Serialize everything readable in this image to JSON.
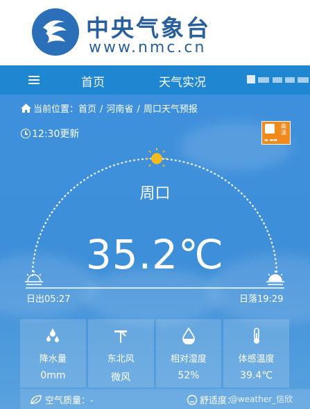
{
  "header": {
    "brand_cn": "中央气象台",
    "brand_url": "www.nmc.cn",
    "logo_icon": "cma-logo-icon"
  },
  "nav": {
    "menu_icon": "hamburger-menu-icon",
    "items": [
      {
        "label": "首页"
      },
      {
        "label": "天气实况"
      }
    ]
  },
  "breadcrumb": {
    "prefix": "当前位置：",
    "parts": [
      "首页",
      "河南省",
      "周口天气预报"
    ],
    "separator": "/"
  },
  "update_time": "12:30更新",
  "alert": {
    "level_text": "高温",
    "color": "#f08a1c"
  },
  "city": "周口",
  "temperature": "35.2℃",
  "sunrise": "日出05:27",
  "sunset": "日落19:29",
  "details": [
    {
      "icon": "raindrops-icon",
      "label": "降水量",
      "value": "0mm"
    },
    {
      "icon": "wind-icon",
      "label": "东北风",
      "value": "微风"
    },
    {
      "icon": "humidity-drop-icon",
      "label": "相对湿度",
      "value": "52%"
    },
    {
      "icon": "thermometer-icon",
      "label": "体感温度",
      "value": "39.4℃"
    }
  ],
  "bottom": {
    "air_quality": "空气质量：-",
    "comfort": "舒适度：",
    "watermark": "@weather_信欣"
  },
  "colors": {
    "brand_blue": "#2a5f9e",
    "nav_blue": "#1f86d2",
    "sun_yellow": "#f5b921"
  }
}
